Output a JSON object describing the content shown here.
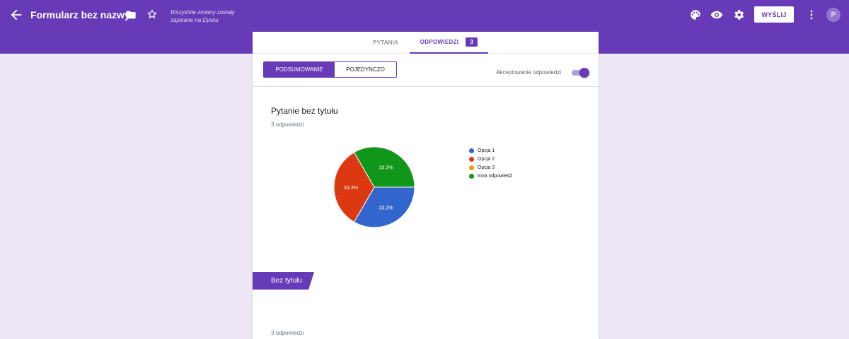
{
  "header": {
    "title": "Formularz bez nazwy",
    "save_status": "Wszystkie zmiany zostały zapisane na Dysku",
    "send_label": "WYŚLIJ",
    "avatar_letter": "P",
    "icons": [
      "back-arrow-icon",
      "folder-icon",
      "star-icon",
      "palette-icon",
      "eye-icon",
      "gear-icon",
      "more-vert-icon"
    ]
  },
  "tabs": {
    "questions_label": "PYTANIA",
    "responses_label": "ODPOWIEDZI",
    "responses_count": "3"
  },
  "view_toggle": {
    "summary_label": "PODSUMOWANIE",
    "individual_label": "POJEDYNCZO"
  },
  "accepting": {
    "label": "Akceptowanie odpowiedzi",
    "on": true
  },
  "question": {
    "title": "Pytanie bez tytułu",
    "response_count": "3 odpowiedzi"
  },
  "section": {
    "title": "Bez tytułu",
    "response_count": "3 odpowiedzi"
  },
  "colors": {
    "brand": "#673ab7",
    "background": "#ede7f6"
  },
  "chart_data": {
    "type": "pie",
    "legend_placement": "right",
    "categories": [
      "Opcja 1",
      "Opcja 2",
      "Opcja 3",
      "Inna odpowiedź"
    ],
    "values": [
      33.3,
      33.3,
      0,
      33.3
    ],
    "labels": [
      "33,3%",
      "33,3%",
      "",
      "33,3%"
    ],
    "colors": [
      "#3366cc",
      "#dc3912",
      "#ff9900",
      "#109618"
    ]
  }
}
